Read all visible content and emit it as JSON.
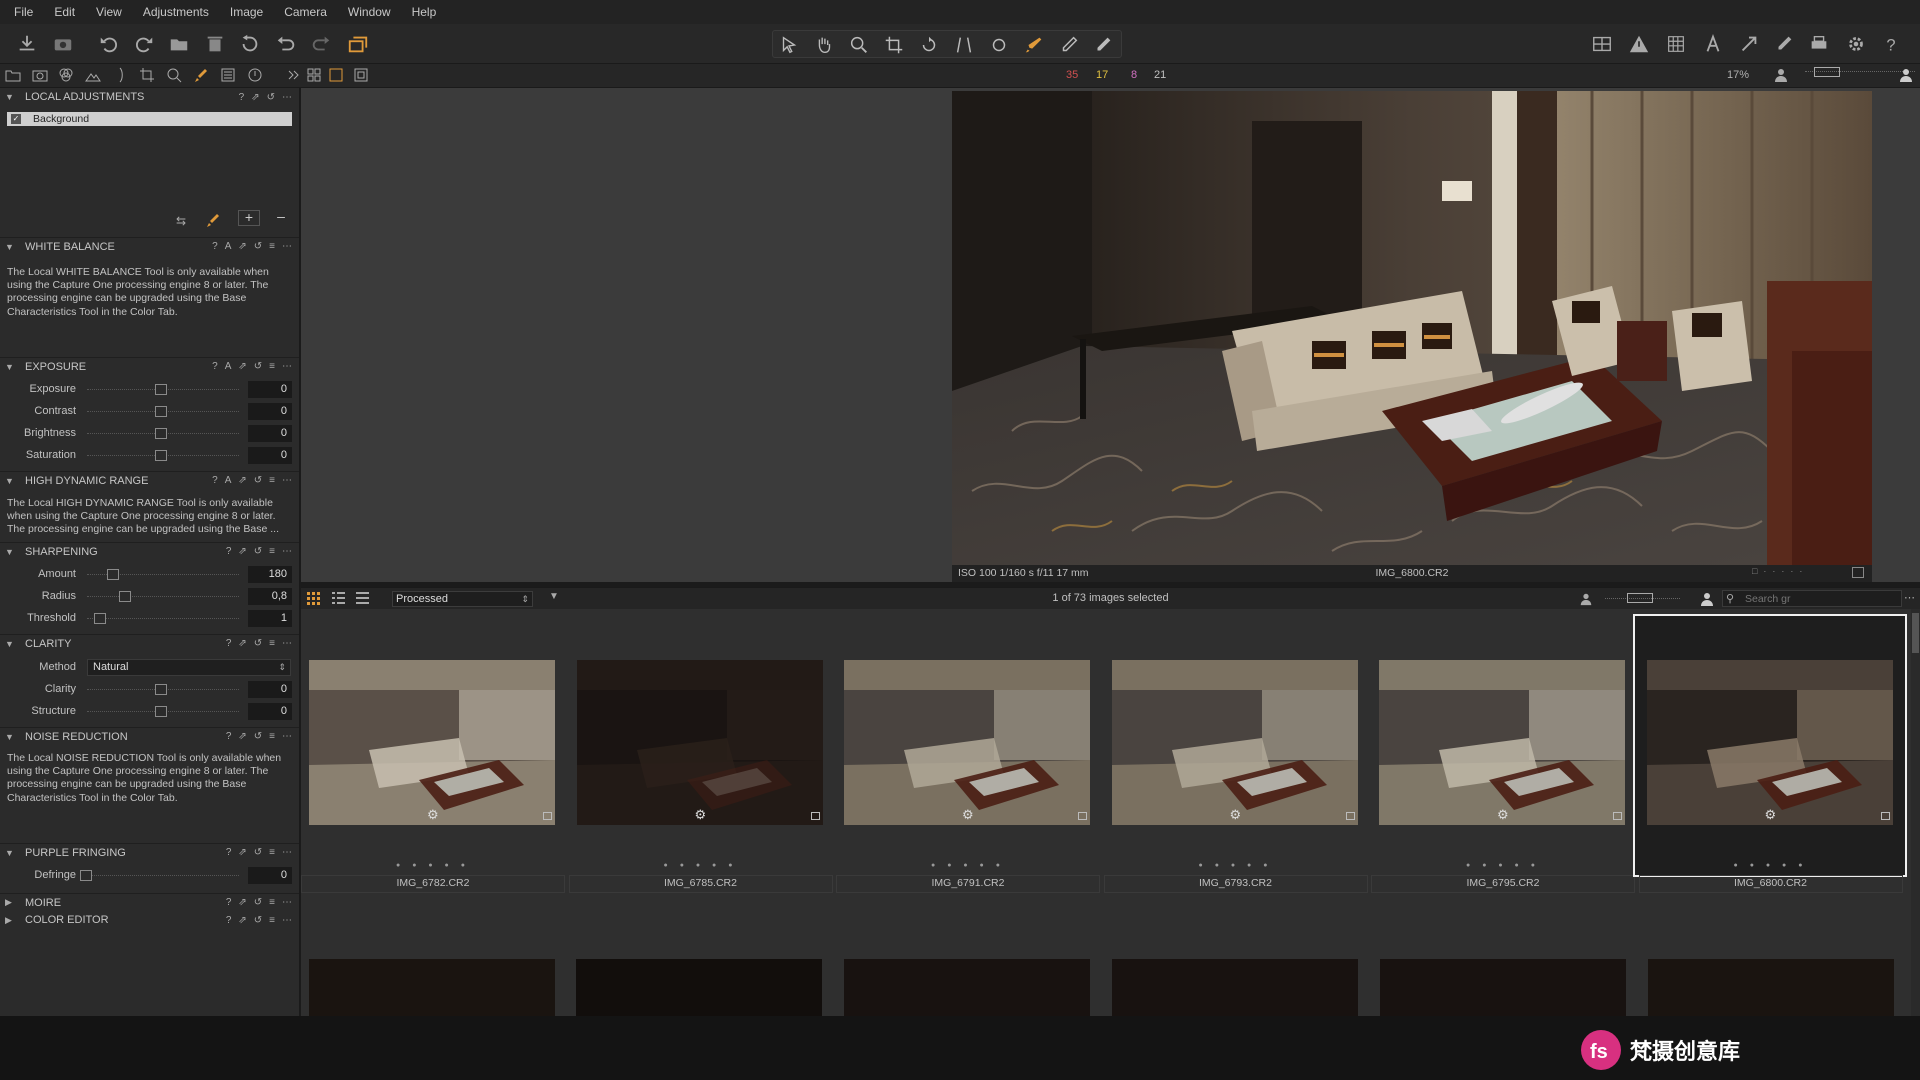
{
  "menu": [
    "File",
    "Edit",
    "View",
    "Adjustments",
    "Image",
    "Camera",
    "Window",
    "Help"
  ],
  "counts": {
    "red": "35",
    "yellow": "17",
    "pink": "8",
    "all": "21"
  },
  "zoom": "17%",
  "panels": {
    "local_adjustments": {
      "title": "LOCAL ADJUSTMENTS",
      "layer": "Background"
    },
    "white_balance": {
      "title": "WHITE BALANCE",
      "note": "The Local WHITE BALANCE Tool is only available when using the Capture One processing engine 8 or later. The processing engine can be upgraded using the Base Characteristics Tool in the Color Tab."
    },
    "exposure": {
      "title": "EXPOSURE",
      "rows": [
        {
          "label": "Exposure",
          "value": "0"
        },
        {
          "label": "Contrast",
          "value": "0"
        },
        {
          "label": "Brightness",
          "value": "0"
        },
        {
          "label": "Saturation",
          "value": "0"
        }
      ]
    },
    "hdr": {
      "title": "HIGH DYNAMIC RANGE",
      "note": "The Local HIGH DYNAMIC RANGE Tool is only available when using the Capture One processing engine 8 or later. The processing engine can be upgraded using the Base ..."
    },
    "sharpening": {
      "title": "SHARPENING",
      "rows": [
        {
          "label": "Amount",
          "value": "180"
        },
        {
          "label": "Radius",
          "value": "0,8"
        },
        {
          "label": "Threshold",
          "value": "1"
        }
      ]
    },
    "clarity": {
      "title": "CLARITY",
      "method_label": "Method",
      "method_value": "Natural",
      "rows": [
        {
          "label": "Clarity",
          "value": "0"
        },
        {
          "label": "Structure",
          "value": "0"
        }
      ]
    },
    "noise": {
      "title": "NOISE REDUCTION",
      "note": "The Local NOISE REDUCTION Tool is only available when using the Capture One processing engine 8 or later. The processing engine can be upgraded using the Base Characteristics Tool in the Color Tab."
    },
    "purple": {
      "title": "PURPLE FRINGING",
      "rows": [
        {
          "label": "Defringe",
          "value": "0"
        }
      ]
    },
    "moire": {
      "title": "MOIRE"
    },
    "color_editor": {
      "title": "COLOR EDITOR"
    }
  },
  "viewer": {
    "exif": "ISO 100  1/160 s  f/11  17 mm",
    "filename": "IMG_6800.CR2"
  },
  "browser": {
    "sort": "Processed",
    "selection": "1 of 73 images selected",
    "search_placeholder": "Search gr",
    "thumbs": [
      {
        "name": "IMG_6782.CR2",
        "selected": false
      },
      {
        "name": "IMG_6785.CR2",
        "selected": false
      },
      {
        "name": "IMG_6791.CR2",
        "selected": false
      },
      {
        "name": "IMG_6793.CR2",
        "selected": false
      },
      {
        "name": "IMG_6795.CR2",
        "selected": false
      },
      {
        "name": "IMG_6800.CR2",
        "selected": true
      }
    ]
  },
  "colors": {
    "accent": "#e09a3a",
    "red": "#d05050",
    "yellow": "#e0c040",
    "pink": "#d070c0"
  },
  "watermark": "梵摄创意库",
  "watermark_logo": "fs"
}
